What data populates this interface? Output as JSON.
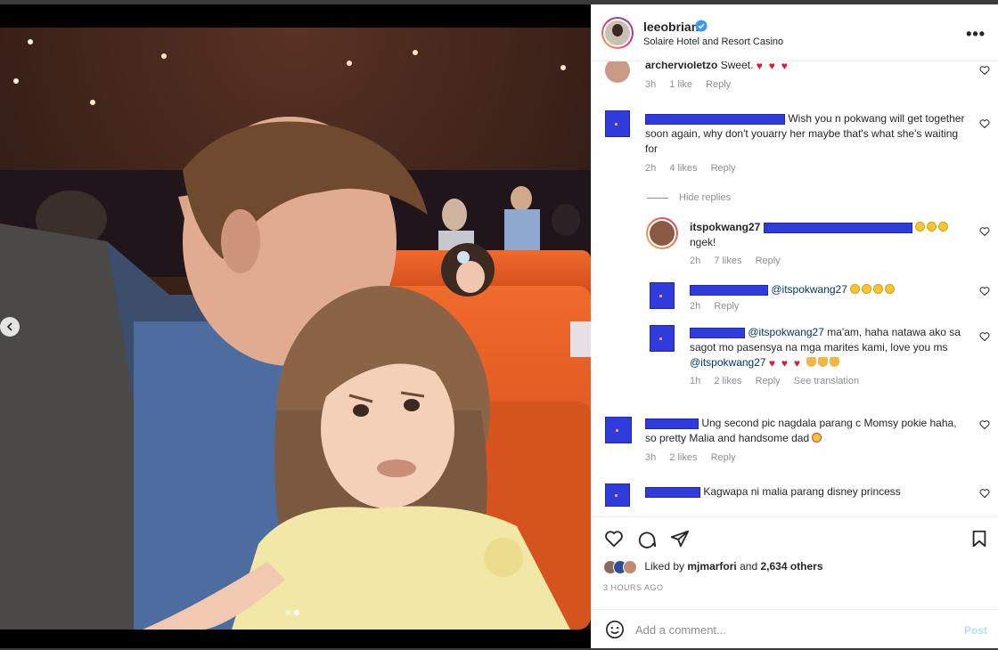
{
  "post": {
    "username": "leeobrian",
    "location": "Solaire Hotel and Resort Casino",
    "more_label": "•••",
    "liked_prefix": "Liked by",
    "liked_user": "mjmarfori",
    "liked_and": "and",
    "liked_others": "2,634 others",
    "time_ago": "3 HOURS AGO",
    "comment_placeholder": "Add a comment...",
    "post_label": "Post",
    "hide_replies": "Hide replies"
  },
  "comments": [
    {
      "user": "archervioletzo",
      "text": "Sweet.",
      "time": "3h",
      "likes": "1 like",
      "reply": "Reply"
    },
    {
      "user": "",
      "text": "Wish you n pokwang will get together soon again, why don't youarry her maybe that's what she's waiting for",
      "time": "2h",
      "likes": "4 likes",
      "reply": "Reply"
    },
    {
      "user": "itspokwang27",
      "text": "ngek!",
      "time": "2h",
      "likes": "7 likes",
      "reply": "Reply"
    },
    {
      "user": "",
      "text": "@itspokwang27",
      "time": "2h",
      "reply": "Reply"
    },
    {
      "user": "",
      "text_prefix": "@itspokwang27",
      "text": "ma'am, haha natawa ako sa sagot mo pasensya na mga marites kami, love you ms",
      "text_mention": "@itspokwang27",
      "time": "1h",
      "likes": "2 likes",
      "reply": "Reply",
      "translate": "See translation"
    },
    {
      "user": "",
      "text": "Ung second pic nagdala parang c Momsy pokie haha, so pretty Malia and handsome dad",
      "time": "3h",
      "likes": "2 likes",
      "reply": "Reply"
    },
    {
      "user": "",
      "text": "Kagwapa ni malia parang disney princess"
    }
  ],
  "icons": {
    "verified": "verified-badge-icon",
    "like": "heart-icon",
    "comment": "comment-bubble-icon",
    "share": "paper-plane-icon",
    "save": "bookmark-icon",
    "emoji": "smiley-icon",
    "prev": "chevron-left-icon"
  },
  "colors": {
    "accent": "#0095f6",
    "verified": "#3897f0",
    "post_disabled": "#b2dffc",
    "redaction": "#2f3bdc"
  }
}
